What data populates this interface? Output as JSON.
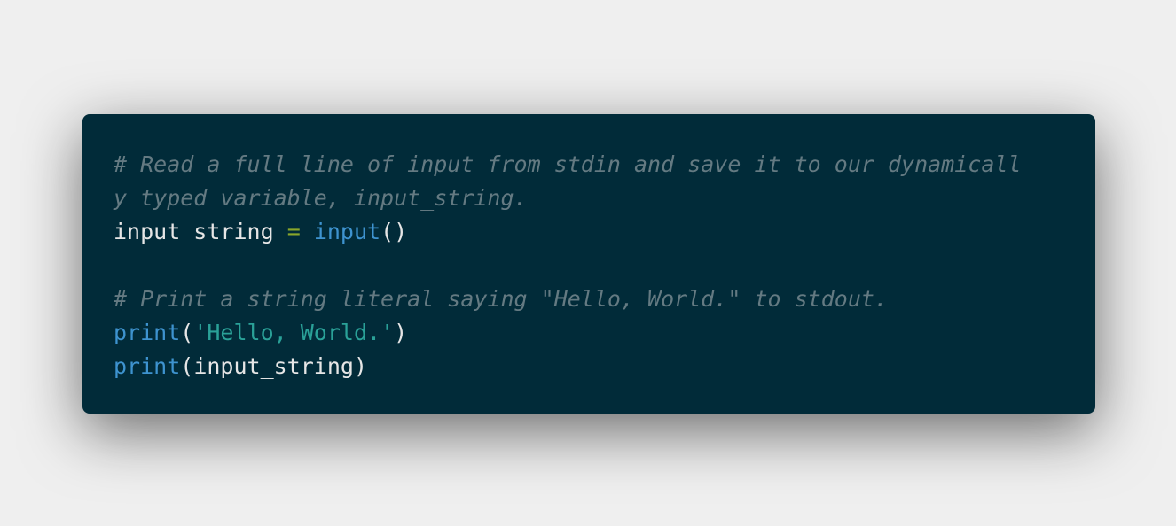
{
  "colors": {
    "page_background": "#efefef",
    "code_background": "#012b39",
    "default_text": "#e6e6e6",
    "comment": "#647a82",
    "operator": "#8aa62a",
    "function": "#3e93cf",
    "string": "#2aa198"
  },
  "code": {
    "language": "python",
    "lines": [
      {
        "comment": "# Read a full line of input from stdin and save it to our dynamicall"
      },
      {
        "comment": "y typed variable, input_string."
      },
      {
        "var": "input_string",
        "space1": " ",
        "op": "=",
        "space2": " ",
        "func": "input",
        "punc": "()"
      },
      {
        "blank": ""
      },
      {
        "comment": "# Print a string literal saying \"Hello, World.\" to stdout."
      },
      {
        "func": "print",
        "open": "(",
        "str": "'Hello, World.'",
        "close": ")"
      },
      {
        "func": "print",
        "open": "(",
        "arg": "input_string",
        "close": ")"
      }
    ]
  }
}
